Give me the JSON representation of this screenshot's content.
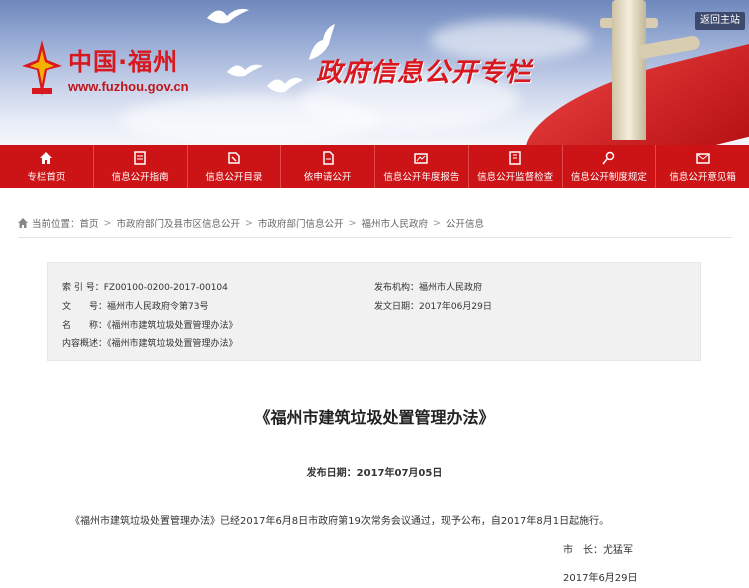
{
  "banner": {
    "logo_text": "中国·福州",
    "logo_url": "www.fuzhou.gov.cn",
    "title": "政府信息公开专栏",
    "back_button": "返回主站"
  },
  "nav": {
    "items": [
      {
        "label": "专栏首页",
        "icon": "home-icon"
      },
      {
        "label": "信息公开指南",
        "icon": "guide-icon"
      },
      {
        "label": "信息公开目录",
        "icon": "catalog-icon"
      },
      {
        "label": "依申请公开",
        "icon": "application-icon"
      },
      {
        "label": "信息公开年度报告",
        "icon": "report-icon"
      },
      {
        "label": "信息公开监督检查",
        "icon": "inspection-icon"
      },
      {
        "label": "信息公开制度规定",
        "icon": "regulation-icon"
      },
      {
        "label": "信息公开意见箱",
        "icon": "mailbox-icon"
      }
    ]
  },
  "breadcrumb": {
    "prefix": "当前位置：",
    "items": [
      "首页",
      "市政府部门及县市区信息公开",
      "市政府部门信息公开",
      "福州市人民政府",
      "公开信息"
    ],
    "separator": ">"
  },
  "info": {
    "index_label": "索 引 号：",
    "index_value": "FZ00100-0200-2017-00104",
    "doc_no_label": "文　　号：",
    "doc_no_value": "福州市人民政府令第73号",
    "name_label": "名　　称：",
    "name_value": "《福州市建筑垃圾处置管理办法》",
    "summary_label": "内容概述：",
    "summary_value": "《福州市建筑垃圾处置管理办法》",
    "issuer_label": "发布机构：",
    "issuer_value": "福州市人民政府",
    "issue_date_label": "发文日期：",
    "issue_date_value": "2017年06月29日"
  },
  "article": {
    "title": "《福州市建筑垃圾处置管理办法》",
    "publish_date": "发布日期：2017年07月05日",
    "body": "《福州市建筑垃圾处置管理办法》已经2017年6月8日市政府第19次常务会议通过，现予公布，自2017年8月1日起施行。",
    "signature": "市　长：尤猛军",
    "sign_date": "2017年6月29日"
  }
}
